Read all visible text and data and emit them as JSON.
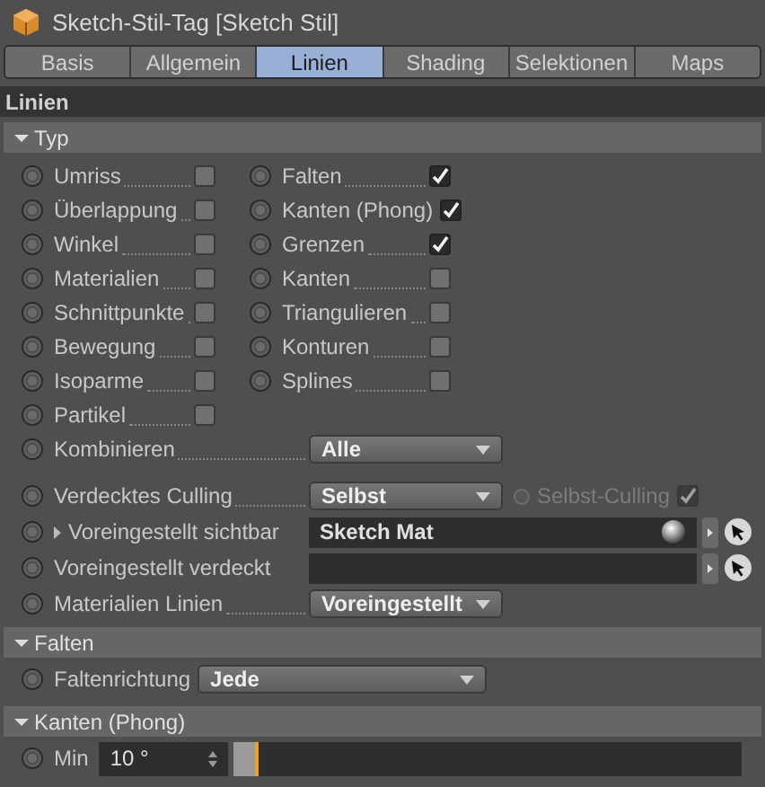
{
  "window": {
    "title": "Sketch-Stil-Tag [Sketch Stil]"
  },
  "tabs": [
    {
      "label": "Basis",
      "selected": false
    },
    {
      "label": "Allgemein",
      "selected": false
    },
    {
      "label": "Linien",
      "selected": true
    },
    {
      "label": "Shading",
      "selected": false
    },
    {
      "label": "Selektionen",
      "selected": false
    },
    {
      "label": "Maps",
      "selected": false
    }
  ],
  "panel_title": "Linien",
  "typ": {
    "header": "Typ",
    "expanded": true,
    "left": [
      {
        "label": "Umriss",
        "checked": false
      },
      {
        "label": "Überlappung",
        "checked": false
      },
      {
        "label": "Winkel",
        "checked": false
      },
      {
        "label": "Materialien",
        "checked": false
      },
      {
        "label": "Schnittpunkte",
        "checked": false
      },
      {
        "label": "Bewegung",
        "checked": false
      },
      {
        "label": "Isoparme",
        "checked": false
      },
      {
        "label": "Partikel",
        "checked": false
      }
    ],
    "right": [
      {
        "label": "Falten",
        "checked": true
      },
      {
        "label": "Kanten (Phong)",
        "checked": true
      },
      {
        "label": "Grenzen",
        "checked": true
      },
      {
        "label": "Kanten",
        "checked": false
      },
      {
        "label": "Triangulieren",
        "checked": false
      },
      {
        "label": "Konturen",
        "checked": false
      },
      {
        "label": "Splines",
        "checked": false
      }
    ],
    "rows": [
      {
        "kind": "dropdown",
        "label": "Kombinieren",
        "value": "Alle"
      },
      {
        "kind": "dropdown",
        "label": "Verdecktes Culling",
        "value": "Selbst",
        "option": {
          "label": "Selbst-Culling",
          "checked": true,
          "disabled": true
        }
      },
      {
        "kind": "link",
        "label": "Voreingestellt sichtbar",
        "value": "Sketch Mat",
        "expandable": true
      },
      {
        "kind": "link",
        "label": "Voreingestellt verdeckt"
      },
      {
        "kind": "dropdown",
        "label": "Materialien Linien",
        "value": "Voreingestellt"
      }
    ]
  },
  "falten": {
    "header": "Falten",
    "expanded": true,
    "label": "Faltenrichtung",
    "value": "Jede"
  },
  "kanten_phong": {
    "header": "Kanten (Phong)",
    "expanded": true,
    "label": "Min",
    "value": "10 °",
    "level": 0.05
  }
}
